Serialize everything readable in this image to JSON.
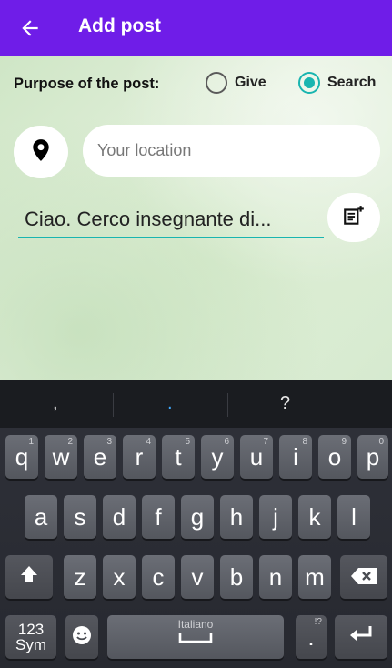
{
  "appbar": {
    "title": "Add post",
    "back_icon": "arrow-left-icon",
    "background": "#6f1de8"
  },
  "form": {
    "purpose_label": "Purpose of the post:",
    "options": [
      {
        "label": "Give",
        "selected": false
      },
      {
        "label": "Search",
        "selected": true
      }
    ],
    "location": {
      "icon": "map-pin-icon",
      "placeholder": "Your location",
      "value": ""
    },
    "message": {
      "value": "Ciao. Cerco insegnante di..."
    },
    "note_icon": "note-add-icon",
    "accent": "#19b5b0"
  },
  "keyboard": {
    "suggestions": [
      ",",
      ".",
      "?"
    ],
    "row1": [
      {
        "k": "q",
        "n": "1"
      },
      {
        "k": "w",
        "n": "2"
      },
      {
        "k": "e",
        "n": "3"
      },
      {
        "k": "r",
        "n": "4"
      },
      {
        "k": "t",
        "n": "5"
      },
      {
        "k": "y",
        "n": "6"
      },
      {
        "k": "u",
        "n": "7"
      },
      {
        "k": "i",
        "n": "8"
      },
      {
        "k": "o",
        "n": "9"
      },
      {
        "k": "p",
        "n": "0"
      }
    ],
    "row2": [
      "a",
      "s",
      "d",
      "f",
      "g",
      "h",
      "j",
      "k",
      "l"
    ],
    "row3": [
      "z",
      "x",
      "c",
      "v",
      "b",
      "n",
      "m"
    ],
    "sym_top": "123",
    "sym_bottom": "Sym",
    "space_label": "Italiano",
    "period": ".",
    "period_hint": "!?"
  }
}
